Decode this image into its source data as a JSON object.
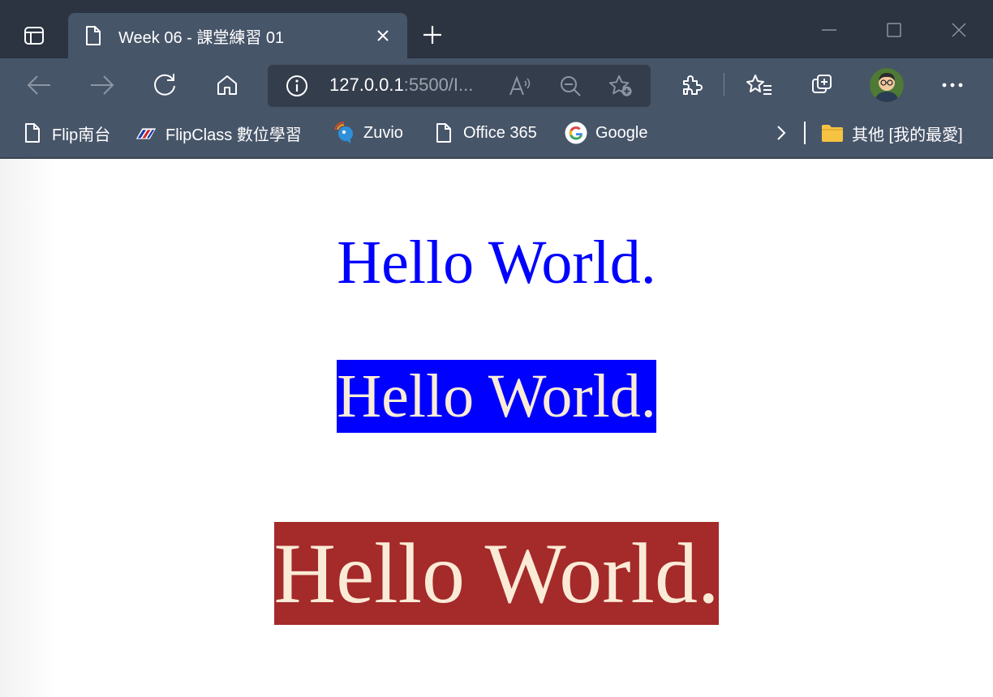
{
  "browser": {
    "tab_title": "Week 06 - 課堂練習 01",
    "url_host": "127.0.0.1",
    "url_rest": ":5500/I...",
    "icons": {
      "tab_actions": "tab-actions-icon",
      "tab_page": "document-icon",
      "tab_close": "close-icon",
      "new_tab": "plus-icon",
      "back": "arrow-left-icon",
      "forward": "arrow-right-icon",
      "refresh": "refresh-icon",
      "home": "home-icon",
      "site_info": "info-icon",
      "read_aloud": "read-aloud-icon",
      "zoom": "zoom-out-icon",
      "add_favorite": "star-add-icon",
      "extensions": "puzzle-icon",
      "favorites": "favorites-list-icon",
      "collections": "collections-icon",
      "profile": "avatar",
      "more": "more-icon"
    }
  },
  "favorites_bar": {
    "items": [
      {
        "label": "Flip南台",
        "icon": "document-icon"
      },
      {
        "label": "FlipClass 數位學習",
        "icon": "flipclass-logo-icon"
      },
      {
        "label": "Zuvio",
        "icon": "zuvio-logo-icon"
      },
      {
        "label": "Office 365",
        "icon": "document-icon"
      },
      {
        "label": "Google",
        "icon": "google-logo-icon"
      }
    ],
    "other_folder": "其他 [我的最愛]"
  },
  "page": {
    "headings": [
      {
        "text": "Hello World.",
        "color": "#0000ff",
        "background": "transparent"
      },
      {
        "text": "Hello World.",
        "color": "#faebd7",
        "background": "#0000ff"
      },
      {
        "text": "Hello World.",
        "color": "#faebd7",
        "background": "#a52a2a"
      }
    ]
  }
}
